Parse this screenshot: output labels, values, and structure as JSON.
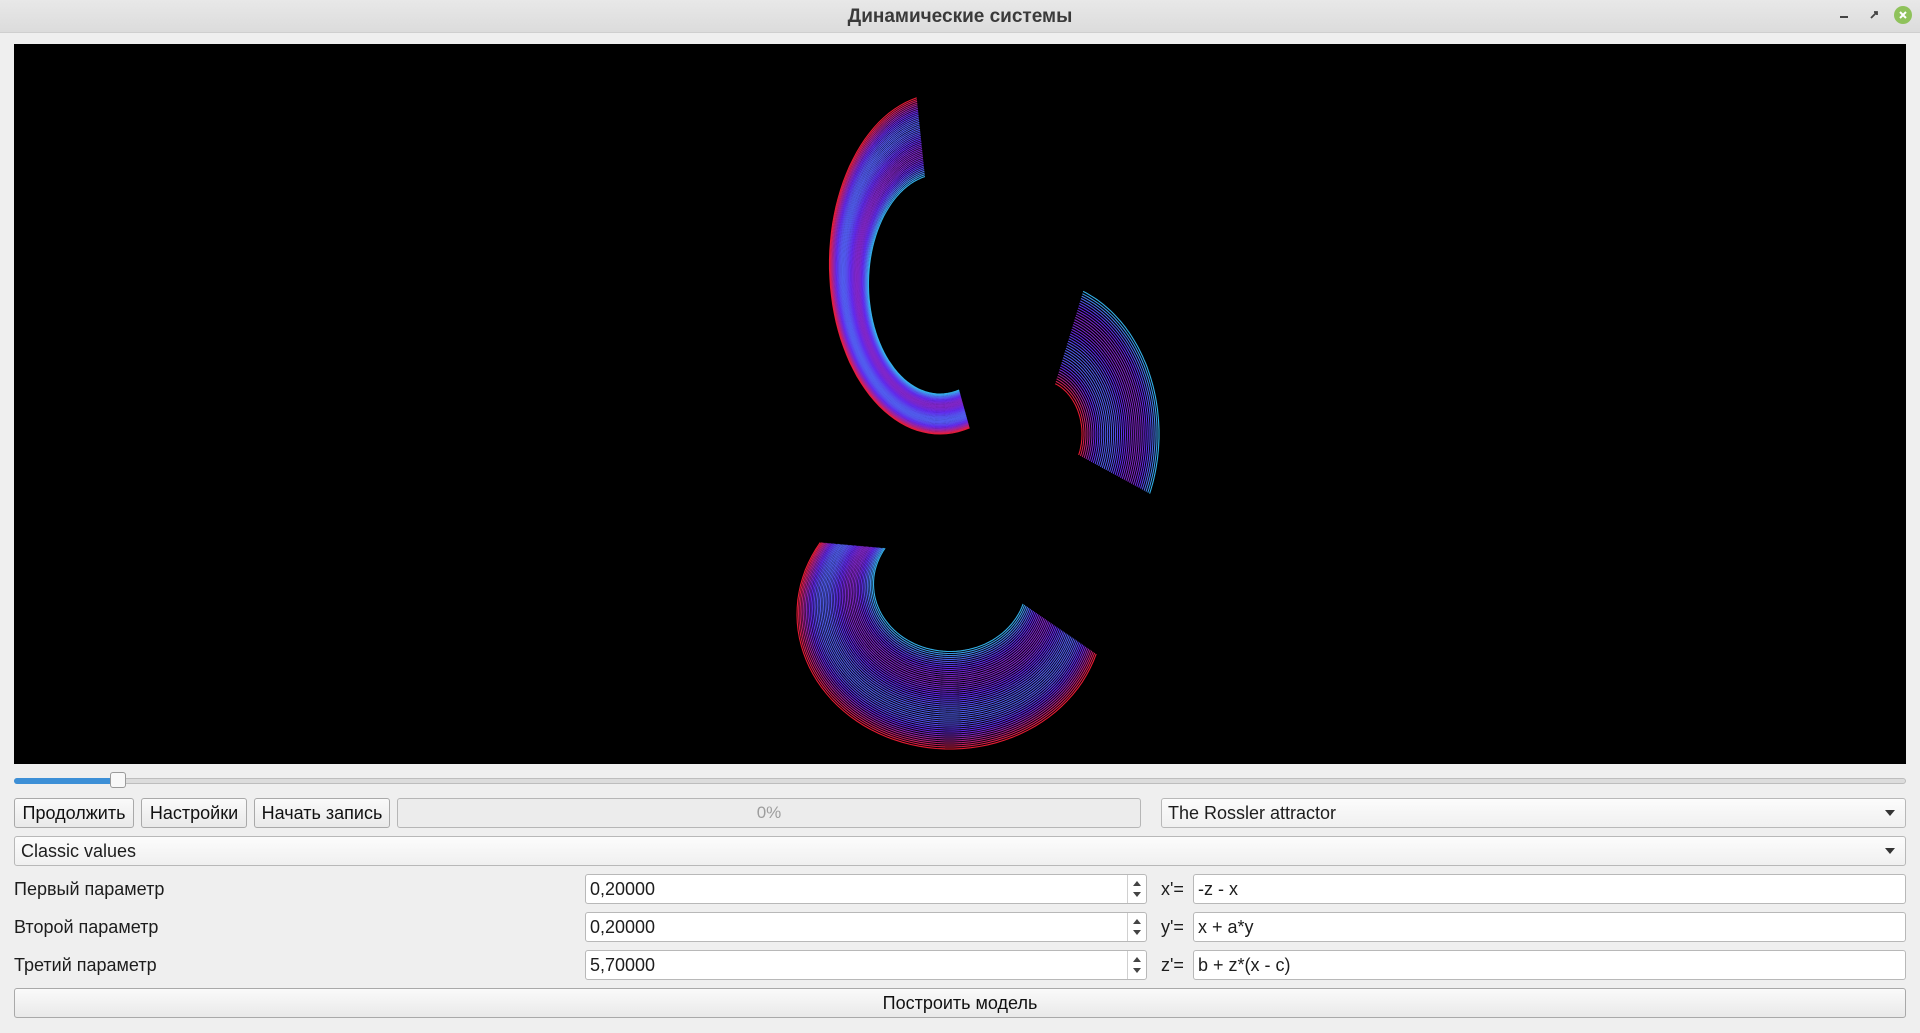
{
  "window": {
    "title": "Динамические системы"
  },
  "colors": {
    "accent": "#3d8fd6",
    "curve_start": "#ff1f3a",
    "curve_mid": "#6a2cff",
    "curve_end": "#2ee6ff"
  },
  "timeline": {
    "progress_fraction": 0.055
  },
  "toolbar": {
    "continue_label": "Продолжить",
    "settings_label": "Настройки",
    "record_label": "Начать запись",
    "progress_text": "0%",
    "system_select": "The Rossler attractor"
  },
  "preset_select": "Classic values",
  "params": [
    {
      "label": "Первый параметр",
      "value": "0,20000"
    },
    {
      "label": "Второй параметр",
      "value": "0,20000"
    },
    {
      "label": "Третий параметр",
      "value": "5,70000"
    }
  ],
  "equations": [
    {
      "label": "x'=",
      "value": "-z - x"
    },
    {
      "label": "y'=",
      "value": "x + a*y"
    },
    {
      "label": "z'=",
      "value": "b + z*(x - c)"
    }
  ],
  "build_label": "Построить модель"
}
